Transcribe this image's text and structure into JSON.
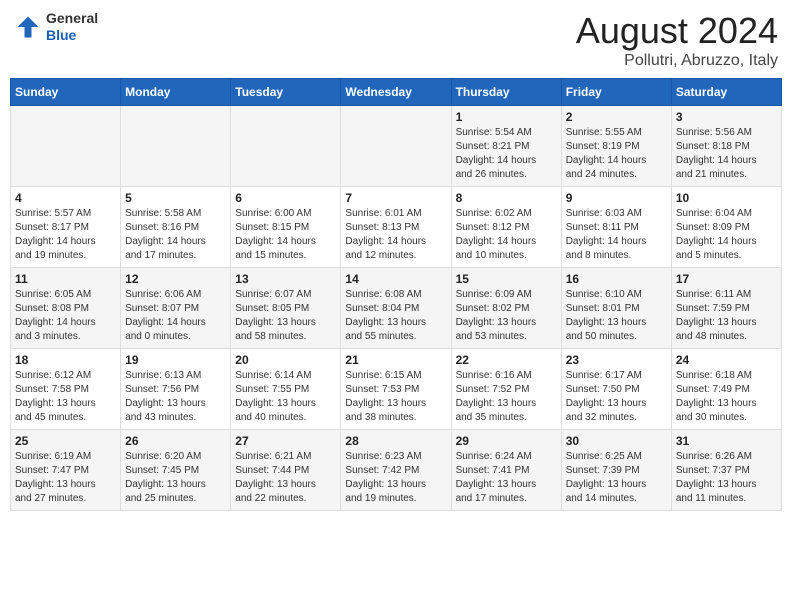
{
  "header": {
    "logo_general": "General",
    "logo_blue": "Blue",
    "title": "August 2024",
    "location": "Pollutri, Abruzzo, Italy"
  },
  "weekdays": [
    "Sunday",
    "Monday",
    "Tuesday",
    "Wednesday",
    "Thursday",
    "Friday",
    "Saturday"
  ],
  "weeks": [
    [
      {
        "day": "",
        "info": ""
      },
      {
        "day": "",
        "info": ""
      },
      {
        "day": "",
        "info": ""
      },
      {
        "day": "",
        "info": ""
      },
      {
        "day": "1",
        "info": "Sunrise: 5:54 AM\nSunset: 8:21 PM\nDaylight: 14 hours\nand 26 minutes."
      },
      {
        "day": "2",
        "info": "Sunrise: 5:55 AM\nSunset: 8:19 PM\nDaylight: 14 hours\nand 24 minutes."
      },
      {
        "day": "3",
        "info": "Sunrise: 5:56 AM\nSunset: 8:18 PM\nDaylight: 14 hours\nand 21 minutes."
      }
    ],
    [
      {
        "day": "4",
        "info": "Sunrise: 5:57 AM\nSunset: 8:17 PM\nDaylight: 14 hours\nand 19 minutes."
      },
      {
        "day": "5",
        "info": "Sunrise: 5:58 AM\nSunset: 8:16 PM\nDaylight: 14 hours\nand 17 minutes."
      },
      {
        "day": "6",
        "info": "Sunrise: 6:00 AM\nSunset: 8:15 PM\nDaylight: 14 hours\nand 15 minutes."
      },
      {
        "day": "7",
        "info": "Sunrise: 6:01 AM\nSunset: 8:13 PM\nDaylight: 14 hours\nand 12 minutes."
      },
      {
        "day": "8",
        "info": "Sunrise: 6:02 AM\nSunset: 8:12 PM\nDaylight: 14 hours\nand 10 minutes."
      },
      {
        "day": "9",
        "info": "Sunrise: 6:03 AM\nSunset: 8:11 PM\nDaylight: 14 hours\nand 8 minutes."
      },
      {
        "day": "10",
        "info": "Sunrise: 6:04 AM\nSunset: 8:09 PM\nDaylight: 14 hours\nand 5 minutes."
      }
    ],
    [
      {
        "day": "11",
        "info": "Sunrise: 6:05 AM\nSunset: 8:08 PM\nDaylight: 14 hours\nand 3 minutes."
      },
      {
        "day": "12",
        "info": "Sunrise: 6:06 AM\nSunset: 8:07 PM\nDaylight: 14 hours\nand 0 minutes."
      },
      {
        "day": "13",
        "info": "Sunrise: 6:07 AM\nSunset: 8:05 PM\nDaylight: 13 hours\nand 58 minutes."
      },
      {
        "day": "14",
        "info": "Sunrise: 6:08 AM\nSunset: 8:04 PM\nDaylight: 13 hours\nand 55 minutes."
      },
      {
        "day": "15",
        "info": "Sunrise: 6:09 AM\nSunset: 8:02 PM\nDaylight: 13 hours\nand 53 minutes."
      },
      {
        "day": "16",
        "info": "Sunrise: 6:10 AM\nSunset: 8:01 PM\nDaylight: 13 hours\nand 50 minutes."
      },
      {
        "day": "17",
        "info": "Sunrise: 6:11 AM\nSunset: 7:59 PM\nDaylight: 13 hours\nand 48 minutes."
      }
    ],
    [
      {
        "day": "18",
        "info": "Sunrise: 6:12 AM\nSunset: 7:58 PM\nDaylight: 13 hours\nand 45 minutes."
      },
      {
        "day": "19",
        "info": "Sunrise: 6:13 AM\nSunset: 7:56 PM\nDaylight: 13 hours\nand 43 minutes."
      },
      {
        "day": "20",
        "info": "Sunrise: 6:14 AM\nSunset: 7:55 PM\nDaylight: 13 hours\nand 40 minutes."
      },
      {
        "day": "21",
        "info": "Sunrise: 6:15 AM\nSunset: 7:53 PM\nDaylight: 13 hours\nand 38 minutes."
      },
      {
        "day": "22",
        "info": "Sunrise: 6:16 AM\nSunset: 7:52 PM\nDaylight: 13 hours\nand 35 minutes."
      },
      {
        "day": "23",
        "info": "Sunrise: 6:17 AM\nSunset: 7:50 PM\nDaylight: 13 hours\nand 32 minutes."
      },
      {
        "day": "24",
        "info": "Sunrise: 6:18 AM\nSunset: 7:49 PM\nDaylight: 13 hours\nand 30 minutes."
      }
    ],
    [
      {
        "day": "25",
        "info": "Sunrise: 6:19 AM\nSunset: 7:47 PM\nDaylight: 13 hours\nand 27 minutes."
      },
      {
        "day": "26",
        "info": "Sunrise: 6:20 AM\nSunset: 7:45 PM\nDaylight: 13 hours\nand 25 minutes."
      },
      {
        "day": "27",
        "info": "Sunrise: 6:21 AM\nSunset: 7:44 PM\nDaylight: 13 hours\nand 22 minutes."
      },
      {
        "day": "28",
        "info": "Sunrise: 6:23 AM\nSunset: 7:42 PM\nDaylight: 13 hours\nand 19 minutes."
      },
      {
        "day": "29",
        "info": "Sunrise: 6:24 AM\nSunset: 7:41 PM\nDaylight: 13 hours\nand 17 minutes."
      },
      {
        "day": "30",
        "info": "Sunrise: 6:25 AM\nSunset: 7:39 PM\nDaylight: 13 hours\nand 14 minutes."
      },
      {
        "day": "31",
        "info": "Sunrise: 6:26 AM\nSunset: 7:37 PM\nDaylight: 13 hours\nand 11 minutes."
      }
    ]
  ]
}
